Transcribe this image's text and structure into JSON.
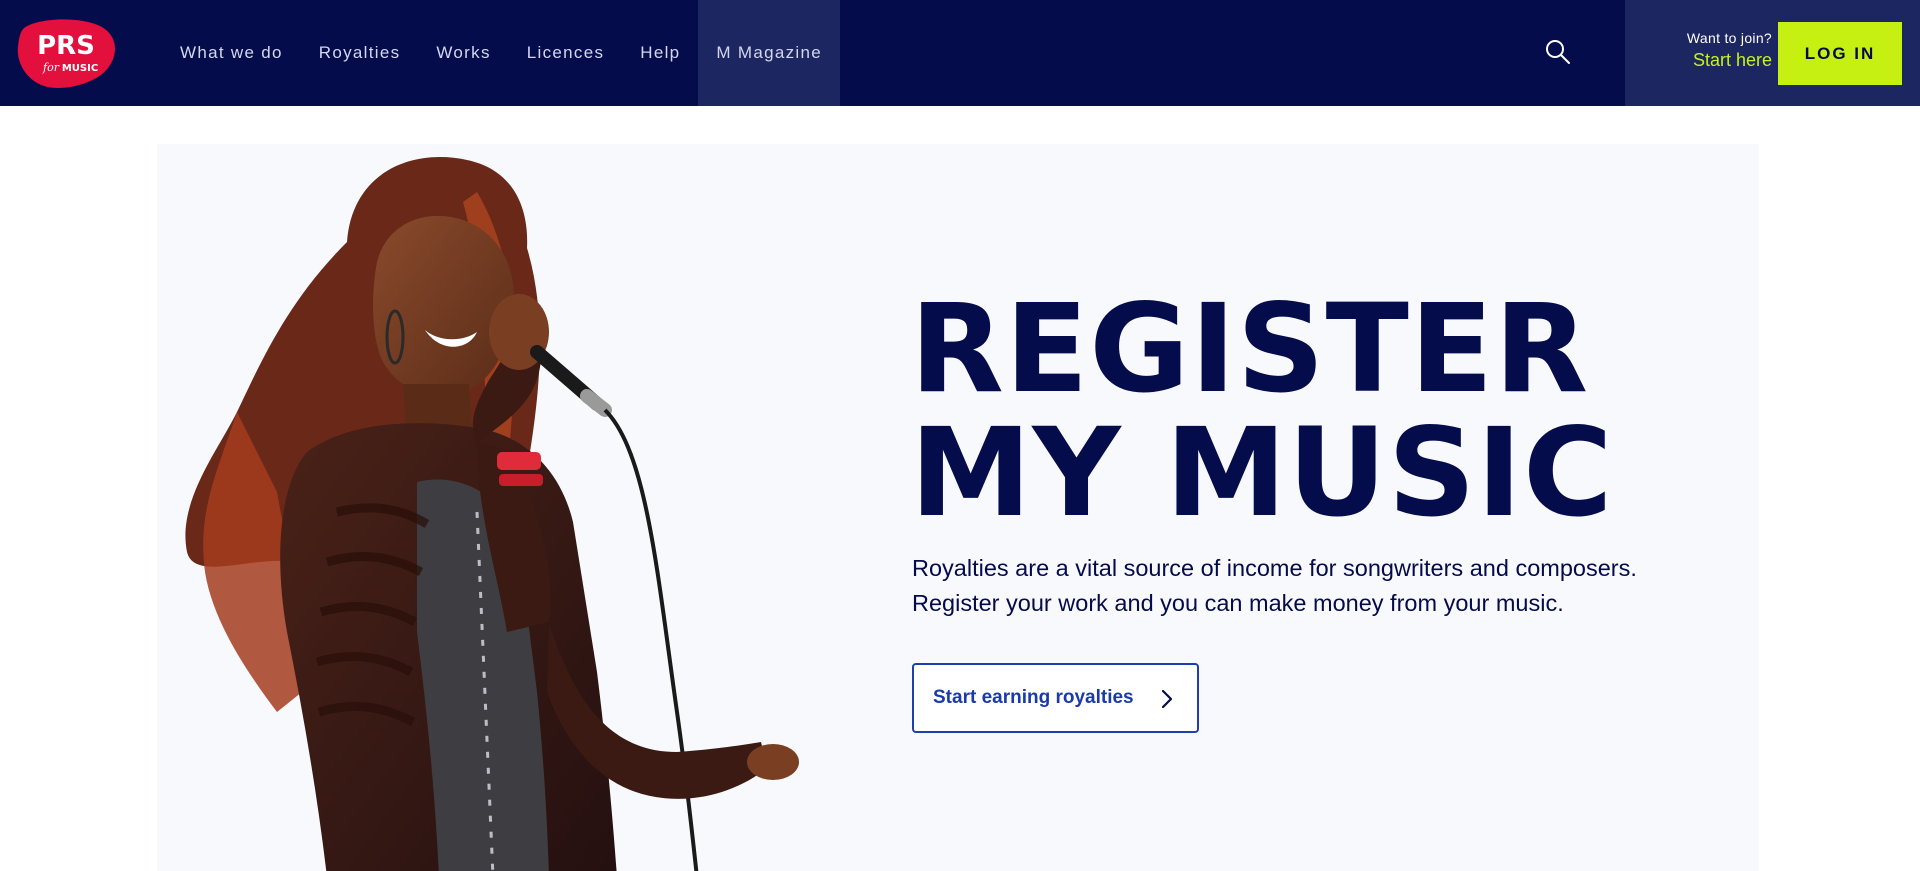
{
  "header": {
    "logo": {
      "text_main": "PRS",
      "text_sub_for": "for",
      "text_sub_music": "MUSIC",
      "brand_color": "#e30f3c"
    },
    "nav": [
      {
        "label": "What we do"
      },
      {
        "label": "Royalties"
      },
      {
        "label": "Works"
      },
      {
        "label": "Licences"
      },
      {
        "label": "Help"
      },
      {
        "label": "M Magazine",
        "active": true
      }
    ],
    "search_icon": "search-icon",
    "join": {
      "label": "Want to join?",
      "link": "Start here"
    },
    "login_label": "LOG IN",
    "colors": {
      "navy": "#050c4b",
      "active": "#1c2660",
      "lime": "#c6f012"
    }
  },
  "hero": {
    "title_lines": [
      "REGISTER",
      "MY MUSIC"
    ],
    "description_lines": [
      "Royalties are a vital source of income for songwriters and composers.",
      "Register your work and you can make money from your music."
    ],
    "cta_label": "Start earning royalties",
    "cta_icon": "chevron-right-icon",
    "image": "singer-with-microphone-photo"
  }
}
